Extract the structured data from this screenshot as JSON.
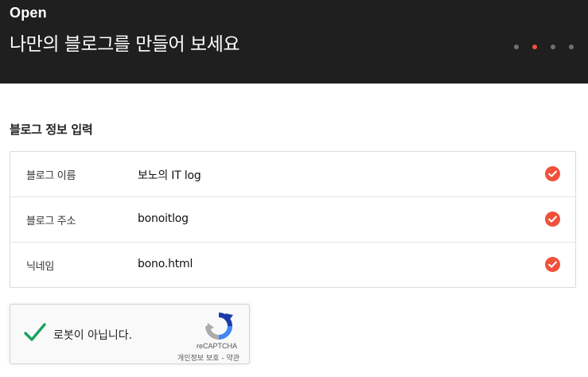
{
  "header": {
    "brand": "Open",
    "headline": "나만의 블로그를 만들어 보세요",
    "slides": {
      "count": 4,
      "active_index": 1
    }
  },
  "section": {
    "title": "블로그 정보 입력"
  },
  "fields": [
    {
      "label": "블로그 이름",
      "value": "보노의 IT log",
      "status": "check-icon"
    },
    {
      "label": "블로그 주소",
      "value": "bonoitlog",
      "status": "check-icon"
    },
    {
      "label": "닉네임",
      "value": "bono.html",
      "status": "check-icon"
    }
  ],
  "captcha": {
    "label": "로봇이 아닙니다.",
    "brand": "reCAPTCHA",
    "privacy_link": "개인정보 보호",
    "separator": "-",
    "terms_link": "약관"
  },
  "colors": {
    "header_bg": "#1f1f1f",
    "accent": "#f0503c",
    "dot_inactive": "#707070",
    "check_green": "#1aa260"
  }
}
